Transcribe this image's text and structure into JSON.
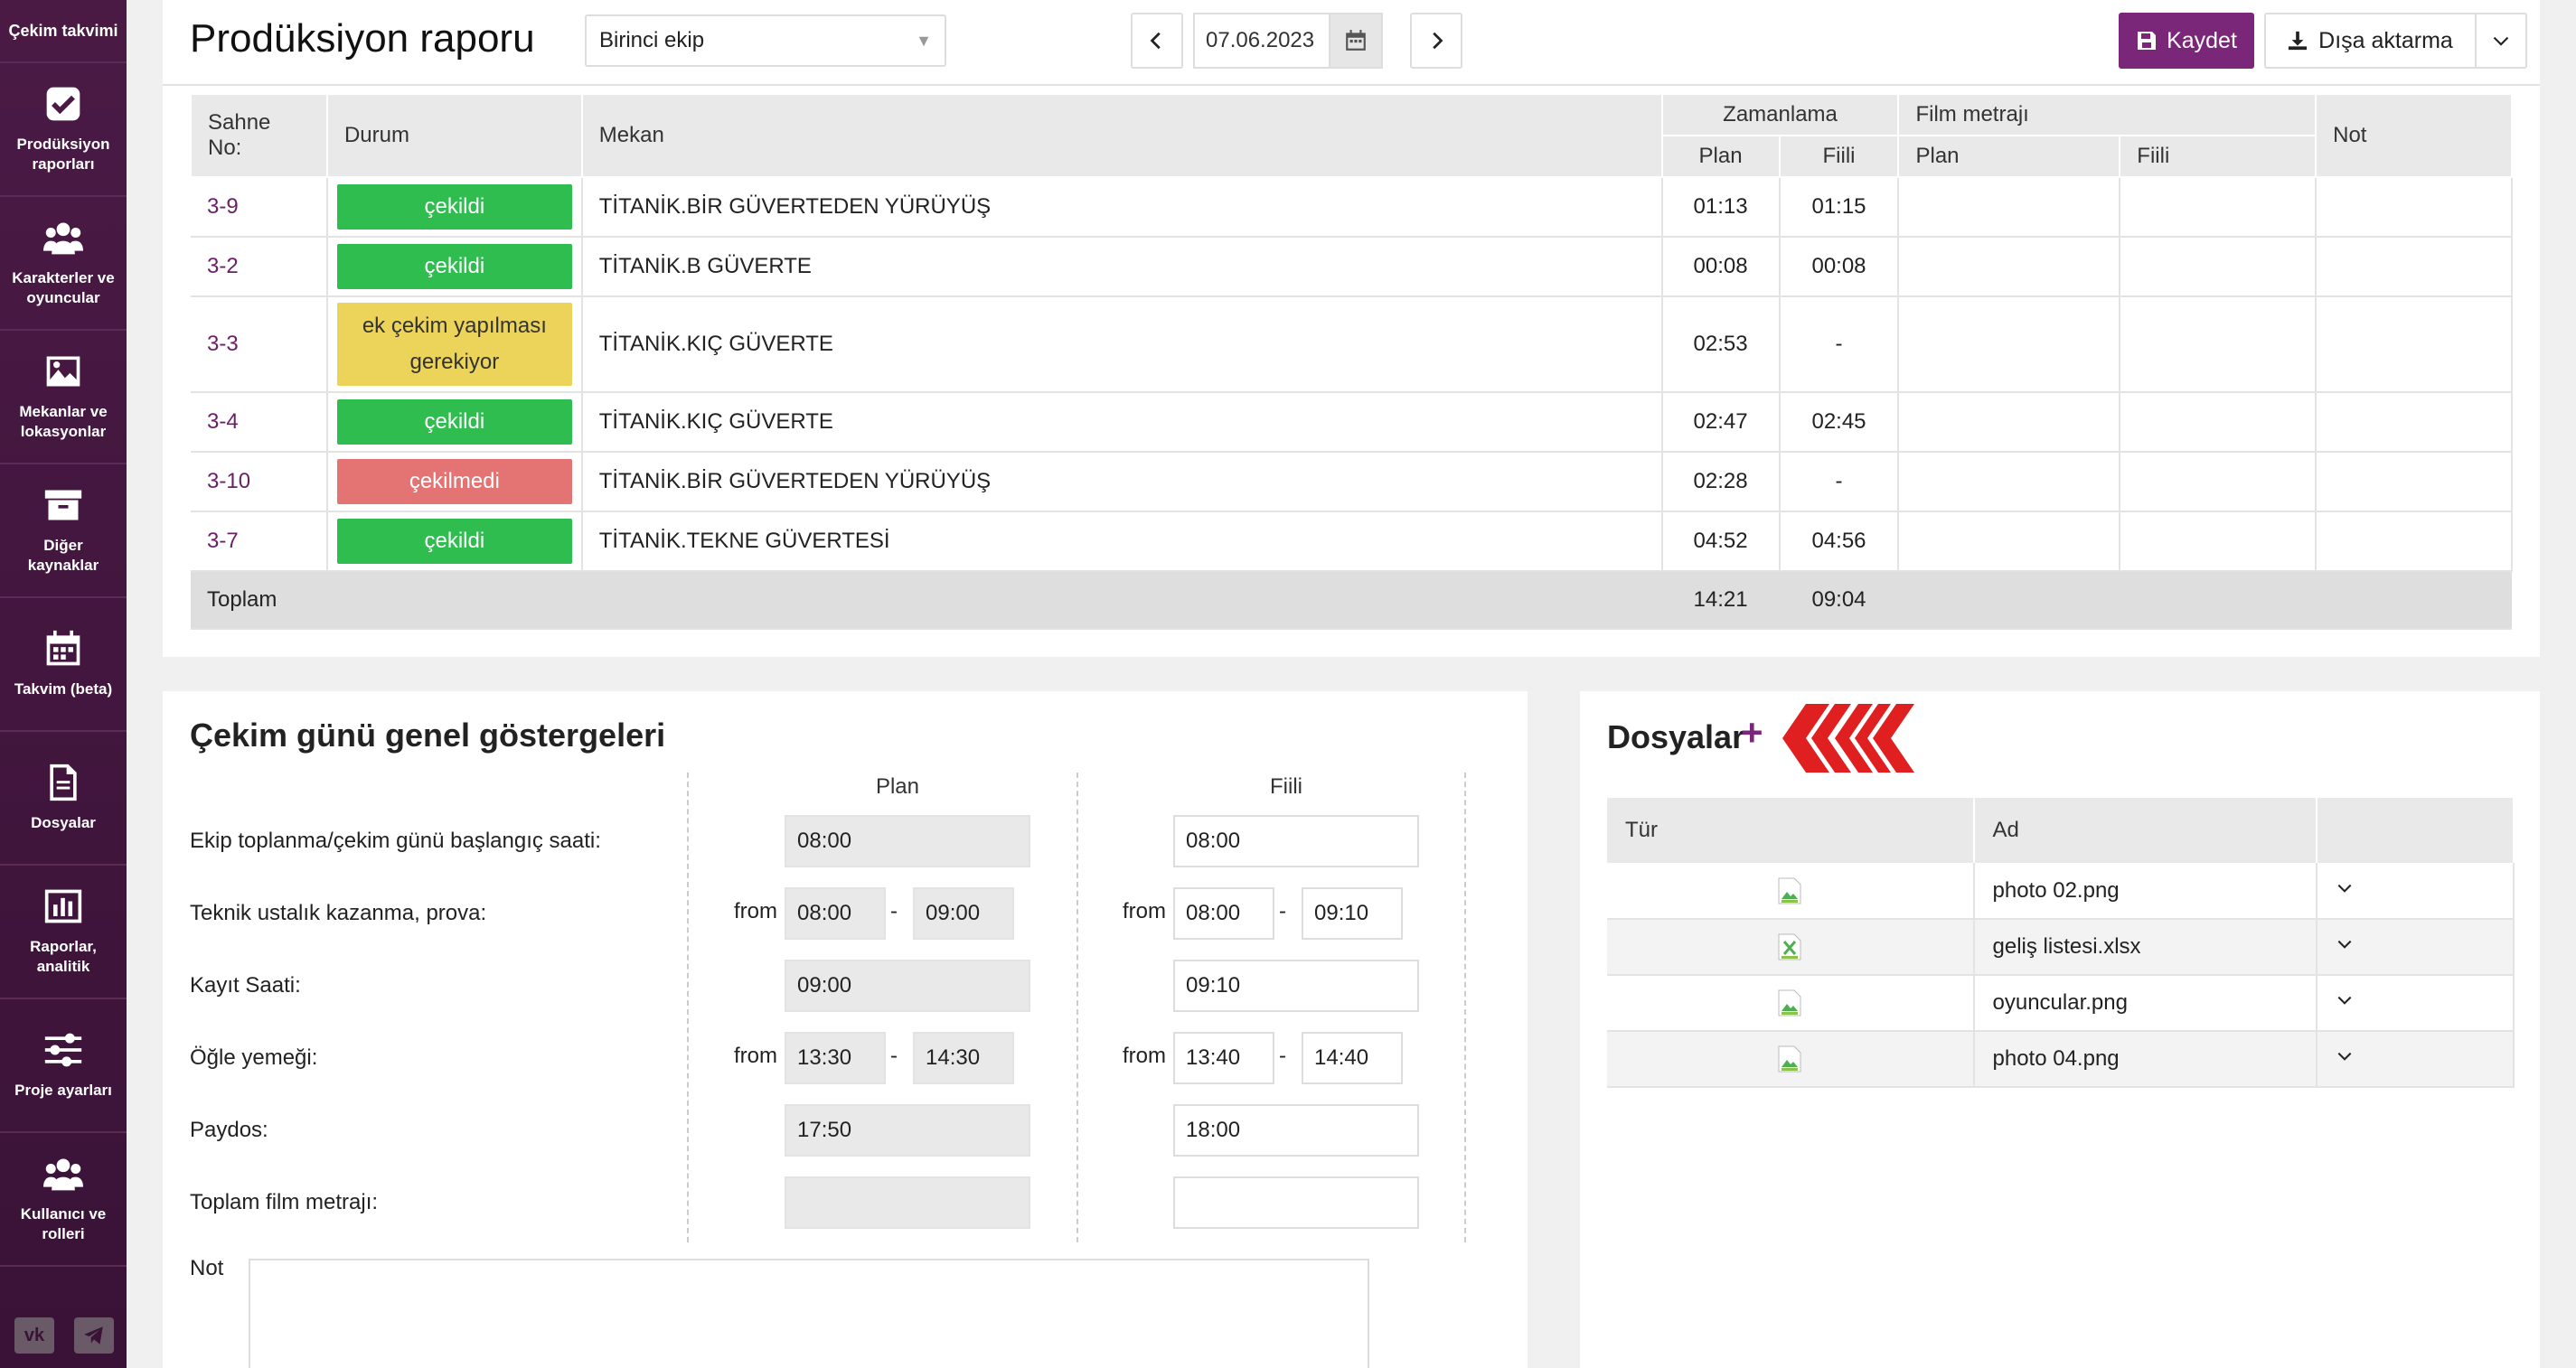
{
  "sidebar": {
    "top_label": "Çekim takvimi",
    "items": [
      {
        "label": "Prodüksiyon raporları",
        "icon": "check-square-icon"
      },
      {
        "label": "Karakterler ve oyuncular",
        "icon": "users-icon"
      },
      {
        "label": "Mekanlar ve lokasyonlar",
        "icon": "image-icon"
      },
      {
        "label": "Diğer kaynaklar",
        "icon": "archive-icon"
      },
      {
        "label": "Takvim (beta)",
        "icon": "calendar-icon"
      },
      {
        "label": "Dosyalar",
        "icon": "file-icon"
      },
      {
        "label": "Raporlar, analitik",
        "icon": "bar-chart-icon"
      },
      {
        "label": "Proje ayarları",
        "icon": "sliders-icon"
      },
      {
        "label": "Kullanıcı ve rolleri",
        "icon": "users-icon"
      }
    ],
    "social": [
      "vk-icon",
      "telegram-icon"
    ]
  },
  "header": {
    "title": "Prodüksiyon raporu",
    "team": "Birinci ekip",
    "date": "07.06.2023",
    "save_label": "Kaydet",
    "export_label": "Dışa aktarma"
  },
  "scenes": {
    "headers": {
      "scene_no": "Sahne No:",
      "status": "Durum",
      "location": "Mekan",
      "timing": "Zamanlama",
      "footage": "Film metrajı",
      "note": "Not",
      "plan": "Plan",
      "actual": "Fiili"
    },
    "rows": [
      {
        "no": "3-9",
        "status": "çekildi",
        "status_color": "#2ebd4e",
        "location": "TİTANİK.BİR GÜVERTEDEN YÜRÜYÜŞ",
        "plan": "01:13",
        "actual": "01:15"
      },
      {
        "no": "3-2",
        "status": "çekildi",
        "status_color": "#2ebd4e",
        "location": "TİTANİK.B GÜVERTE",
        "plan": "00:08",
        "actual": "00:08"
      },
      {
        "no": "3-3",
        "status": "ek çekim yapılması gerekiyor",
        "status_color": "#ecd45a",
        "location": "TİTANİK.KIÇ GÜVERTE",
        "plan": "02:53",
        "actual": "-"
      },
      {
        "no": "3-4",
        "status": "çekildi",
        "status_color": "#2ebd4e",
        "location": "TİTANİK.KIÇ GÜVERTE",
        "plan": "02:47",
        "actual": "02:45"
      },
      {
        "no": "3-10",
        "status": "çekilmedi",
        "status_color": "#e47474",
        "location": "TİTANİK.BİR GÜVERTEDEN YÜRÜYÜŞ",
        "plan": "02:28",
        "actual": "-"
      },
      {
        "no": "3-7",
        "status": "çekildi",
        "status_color": "#2ebd4e",
        "location": "TİTANİK.TEKNE GÜVERTESİ",
        "plan": "04:52",
        "actual": "04:56"
      }
    ],
    "total": {
      "label": "Toplam",
      "plan": "14:21",
      "actual": "09:04"
    }
  },
  "indicators": {
    "title": "Çekim günü genel göstergeleri",
    "plan_header": "Plan",
    "actual_header": "Fiili",
    "from_label": "from",
    "dash": "-",
    "rows": {
      "gathering": {
        "label": "Ekip toplanma/çekim günü başlangıç saati:",
        "plan": "08:00",
        "actual": "08:00"
      },
      "rehearsal": {
        "label": "Teknik ustalık kazanma, prova:",
        "plan_from": "08:00",
        "plan_to": "09:00",
        "actual_from": "08:00",
        "actual_to": "09:10"
      },
      "recording": {
        "label": "Kayıt Saati:",
        "plan": "09:00",
        "actual": "09:10"
      },
      "lunch": {
        "label": "Öğle yemeği:",
        "plan_from": "13:30",
        "plan_to": "14:30",
        "actual_from": "13:40",
        "actual_to": "14:40"
      },
      "wrap": {
        "label": "Paydos:",
        "plan": "17:50",
        "actual": "18:00"
      },
      "footage": {
        "label": "Toplam film metrajı:",
        "plan": "",
        "actual": ""
      }
    },
    "note_label": "Not"
  },
  "files": {
    "title": "Dosyalar",
    "plus": "+",
    "headers": {
      "type": "Tür",
      "name": "Ad"
    },
    "rows": [
      {
        "name": "photo 02.png",
        "type_icon": "png-file-icon"
      },
      {
        "name": "geliş listesi.xlsx",
        "type_icon": "xlsx-file-icon"
      },
      {
        "name": "oyuncular.png",
        "type_icon": "png-file-icon"
      },
      {
        "name": "photo 04.png",
        "type_icon": "png-file-icon"
      }
    ]
  },
  "colors": {
    "brand": "#7a2779",
    "sidebar": "#3a1237",
    "shot": "#2ebd4e",
    "not_shot": "#e47474",
    "reshoot": "#ecd45a",
    "arrow": "#e02020"
  }
}
